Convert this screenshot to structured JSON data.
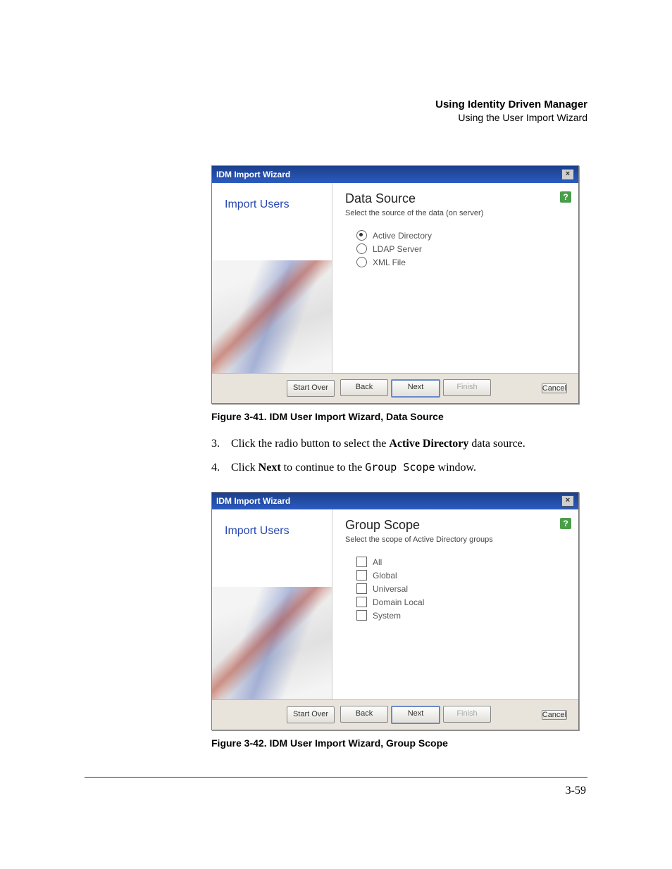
{
  "header": {
    "title": "Using Identity Driven Manager",
    "subtitle": "Using the User Import Wizard"
  },
  "dialog1": {
    "windowTitle": "IDM Import Wizard",
    "sidebarLabel": "Import Users",
    "pageTitle": "Data Source",
    "pageDesc": "Select the source of the data (on server)",
    "help": "?",
    "close": "×",
    "options": {
      "o1": "Active Directory",
      "o2": "LDAP Server",
      "o3": "XML File"
    },
    "buttons": {
      "startOver": "Start Over",
      "back": "Back",
      "next": "Next",
      "finish": "Finish",
      "cancel": "Cancel"
    }
  },
  "caption1": "Figure 3-41. IDM User Import Wizard, Data Source",
  "step3": {
    "num": "3.",
    "pre": "Click the radio button to select the ",
    "bold": "Active Directory",
    "post": " data source."
  },
  "step4": {
    "num": "4.",
    "pre": "Click ",
    "bold": "Next",
    "mid": " to continue to the ",
    "mono": "Group Scope",
    "post": " window."
  },
  "dialog2": {
    "windowTitle": "IDM Import Wizard",
    "sidebarLabel": "Import Users",
    "pageTitle": "Group Scope",
    "pageDesc": "Select the scope of Active Directory groups",
    "help": "?",
    "close": "×",
    "options": {
      "o1": "All",
      "o2": "Global",
      "o3": "Universal",
      "o4": "Domain Local",
      "o5": "System"
    },
    "buttons": {
      "startOver": "Start Over",
      "back": "Back",
      "next": "Next",
      "finish": "Finish",
      "cancel": "Cancel"
    }
  },
  "caption2": "Figure 3-42. IDM User Import Wizard, Group Scope",
  "pageNumber": "3-59"
}
